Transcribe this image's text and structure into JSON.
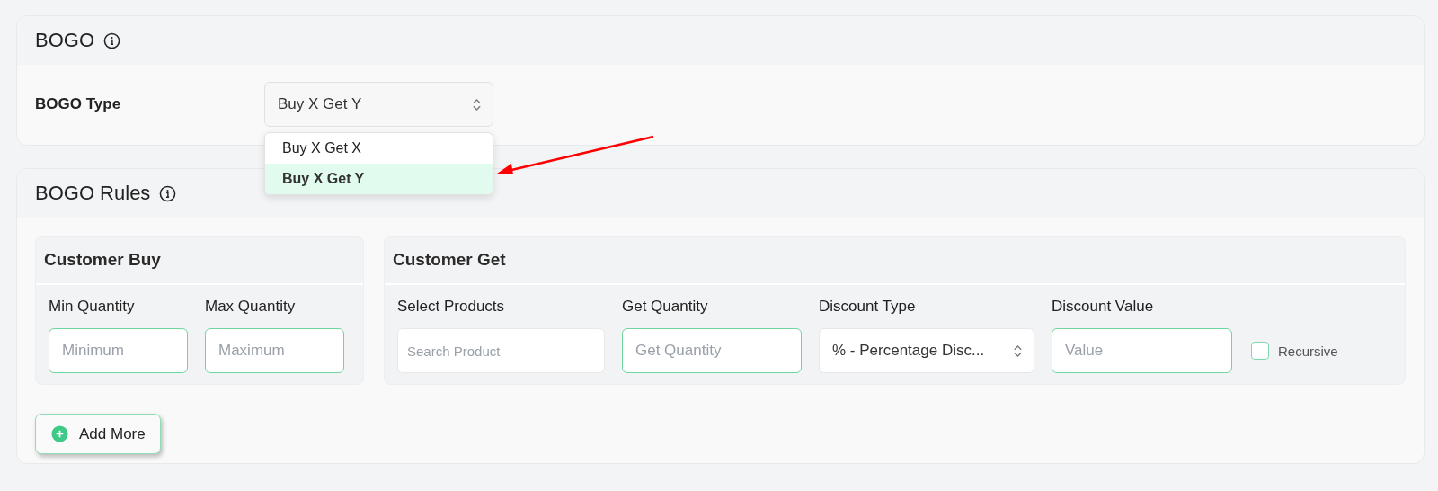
{
  "bogo_card": {
    "title": "BOGO",
    "type_field": {
      "label": "BOGO Type",
      "value": "Buy X Get Y",
      "expanded": true,
      "options": [
        {
          "label": "Buy X Get X",
          "selected": false
        },
        {
          "label": "Buy X Get Y",
          "selected": true
        }
      ]
    }
  },
  "rules_card": {
    "title": "BOGO Rules",
    "customer_buy": {
      "title": "Customer Buy",
      "fields": [
        {
          "kind": "input",
          "label": "Min Quantity",
          "placeholder": "Minimum"
        },
        {
          "kind": "input",
          "label": "Max Quantity",
          "placeholder": "Maximum"
        }
      ]
    },
    "customer_get": {
      "title": "Customer Get",
      "fields": [
        {
          "kind": "search",
          "label": "Select Products",
          "placeholder": "Search Product"
        },
        {
          "kind": "input",
          "label": "Get Quantity",
          "placeholder": "Get Quantity"
        },
        {
          "kind": "select",
          "label": "Discount Type",
          "value": "% - Percentage Disc..."
        },
        {
          "kind": "input",
          "label": "Discount Value",
          "placeholder": "Value"
        }
      ],
      "recursive": {
        "label": "Recursive",
        "checked": false
      }
    },
    "add_button": "Add More"
  }
}
